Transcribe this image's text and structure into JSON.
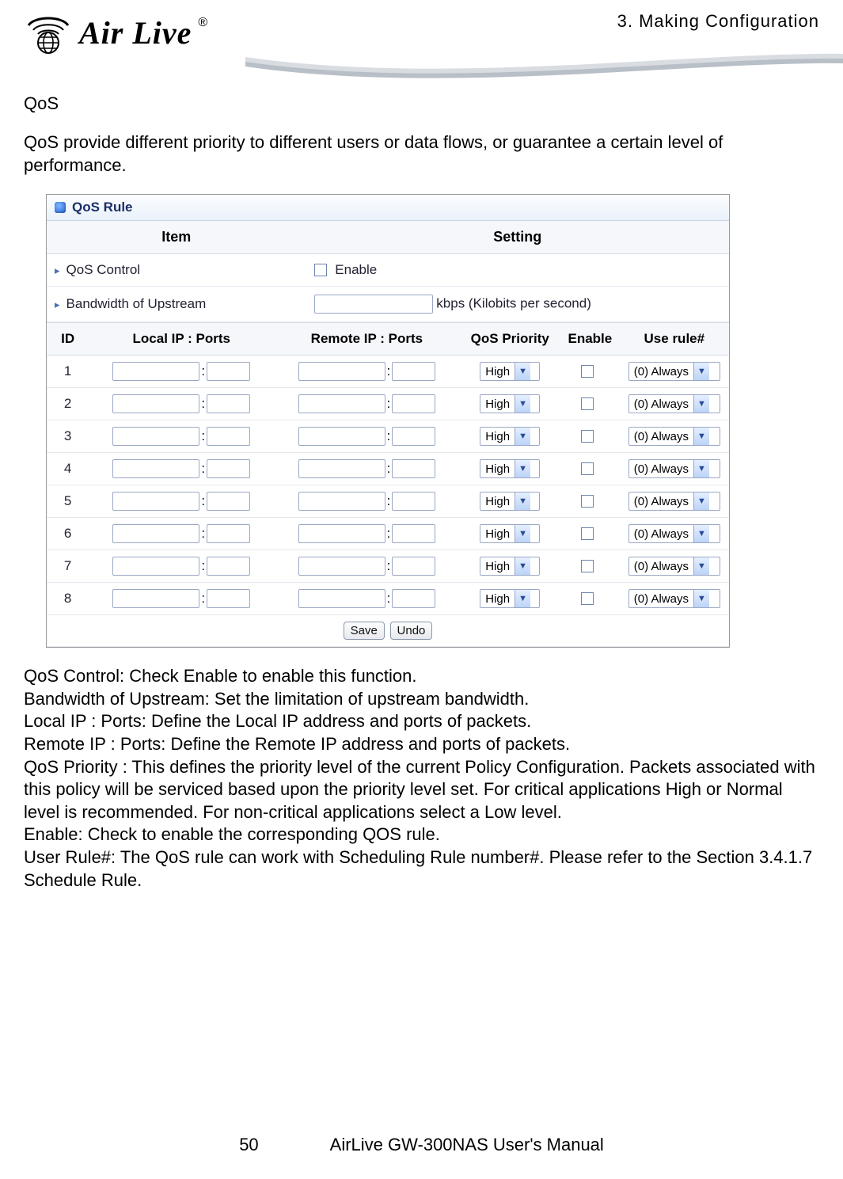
{
  "header": {
    "chapter": "3. Making Configuration",
    "logo_text": "Air Live",
    "logo_reg": "®"
  },
  "section_title": "QoS",
  "intro": "QoS provide different priority to different users or data flows, or guarantee a certain level of performance.",
  "panel": {
    "title": "QoS Rule",
    "columns": {
      "item": "Item",
      "setting": "Setting"
    },
    "qos_control": {
      "label": "QoS Control",
      "checkbox_label": "Enable"
    },
    "bandwidth": {
      "label": "Bandwidth of Upstream",
      "unit": "kbps (Kilobits per second)",
      "value": ""
    },
    "rule_headers": {
      "id": "ID",
      "local": "Local IP : Ports",
      "remote": "Remote IP : Ports",
      "priority": "QoS Priority",
      "enable": "Enable",
      "use_rule": "Use rule#"
    },
    "priority_default": "High",
    "use_rule_default": "(0) Always",
    "rows": [
      {
        "id": "1"
      },
      {
        "id": "2"
      },
      {
        "id": "3"
      },
      {
        "id": "4"
      },
      {
        "id": "5"
      },
      {
        "id": "6"
      },
      {
        "id": "7"
      },
      {
        "id": "8"
      }
    ],
    "buttons": {
      "save": "Save",
      "undo": "Undo"
    }
  },
  "descriptions": {
    "d1": "QoS Control: Check Enable to enable this function.",
    "d2": "Bandwidth of Upstream: Set the limitation of upstream bandwidth.",
    "d3": "Local IP : Ports: Define the Local IP address and ports of packets.",
    "d4": "Remote IP : Ports: Define the Remote IP address and ports of packets.",
    "d5": "QoS Priority : This defines the priority level of the current Policy Configuration. Packets associated with this policy will be serviced based upon the priority level set. For critical applications High or Normal level is recommended. For non-critical applications select a Low level.",
    "d6": "Enable: Check to enable the corresponding QOS rule.",
    "d7": "User Rule#: The QoS rule can work with Scheduling Rule number#. Please refer to the Section 3.4.1.7 Schedule Rule."
  },
  "footer": {
    "page": "50",
    "manual": "AirLive GW-300NAS User's Manual"
  }
}
